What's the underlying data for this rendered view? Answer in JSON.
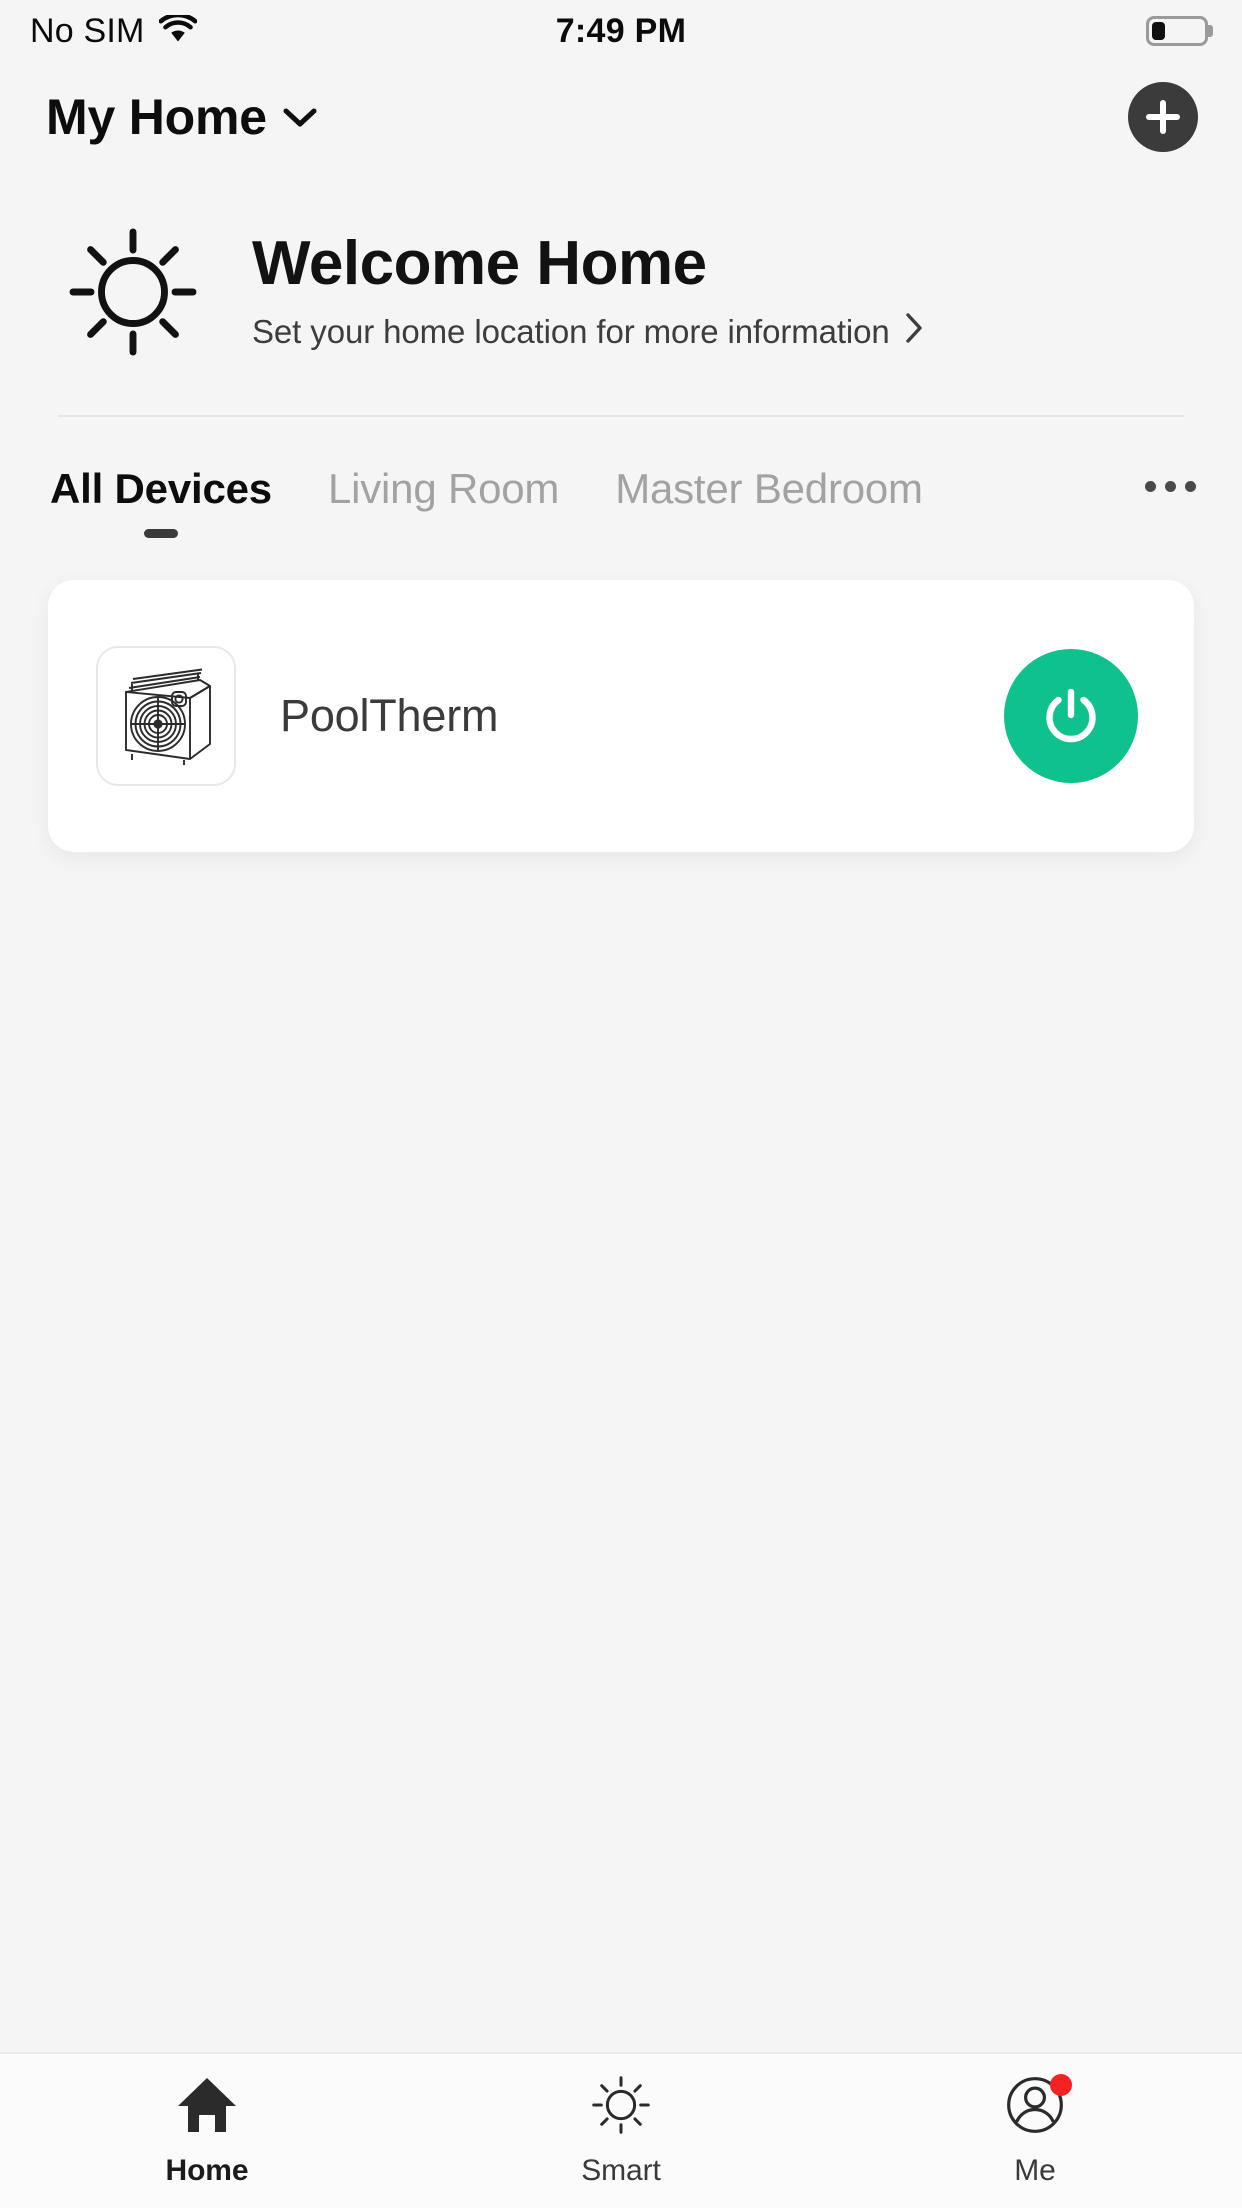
{
  "status_bar": {
    "carrier": "No SIM",
    "wifi_icon": "wifi-icon",
    "time": "7:49 PM",
    "battery_icon": "battery-icon",
    "battery_level_percent": 25
  },
  "header": {
    "home_name": "My Home",
    "chevron_icon": "chevron-down-icon",
    "add_button_icon": "plus-icon"
  },
  "welcome": {
    "weather_icon": "sun-icon",
    "title": "Welcome Home",
    "subtitle": "Set your home location for more information",
    "subtitle_chevron_icon": "chevron-right-icon"
  },
  "tabs": {
    "items": [
      {
        "label": "All Devices",
        "active": true
      },
      {
        "label": "Living Room",
        "active": false
      },
      {
        "label": "Master Bedroom",
        "active": false
      }
    ],
    "more_icon": "ellipsis-icon"
  },
  "devices": [
    {
      "name": "PoolTherm",
      "icon": "heat-pump-icon",
      "power_state": "on",
      "power_icon": "power-icon",
      "power_color": "#0ec18d"
    }
  ],
  "bottom_nav": {
    "items": [
      {
        "label": "Home",
        "icon": "home-icon",
        "active": true,
        "badge": false
      },
      {
        "label": "Smart",
        "icon": "sun-outline-icon",
        "active": false,
        "badge": false
      },
      {
        "label": "Me",
        "icon": "person-circle-icon",
        "active": false,
        "badge": true
      }
    ],
    "badge_color": "#f42222"
  },
  "colors": {
    "background": "#f5f5f5",
    "card": "#ffffff",
    "accent_green": "#0ec18d",
    "dark": "#3b3b3b",
    "muted_text": "#a2a2a2"
  }
}
